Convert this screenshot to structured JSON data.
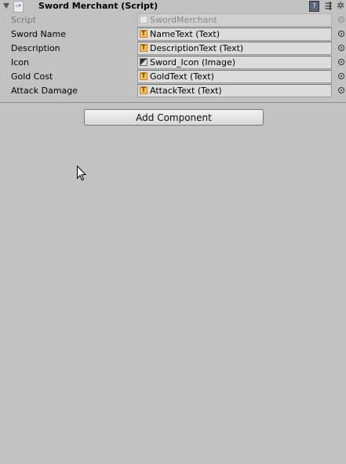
{
  "component": {
    "title": "Sword Merchant (Script)",
    "icons": [
      "foldout-arrow-icon",
      "csharp-script-icon",
      "help-icon",
      "preset-icon",
      "gear-icon"
    ],
    "fields": [
      {
        "label": "Script",
        "value": "SwordMerchant",
        "icon": "script-icon",
        "disabled": true
      },
      {
        "label": "Sword Name",
        "value": "NameText (Text)",
        "icon": "text-icon"
      },
      {
        "label": "Description",
        "value": "DescriptionText (Text)",
        "icon": "text-icon"
      },
      {
        "label": "Icon",
        "value": "Sword_Icon (Image)",
        "icon": "image-icon"
      },
      {
        "label": "Gold Cost",
        "value": "GoldText (Text)",
        "icon": "text-icon"
      },
      {
        "label": "Attack Damage",
        "value": "AttackText (Text)",
        "icon": "text-icon"
      }
    ]
  },
  "add_component_label": "Add Component",
  "colors": {
    "background": "#c2c2c2",
    "field": "#dcdcdc",
    "text_icon": "#f4c060"
  }
}
